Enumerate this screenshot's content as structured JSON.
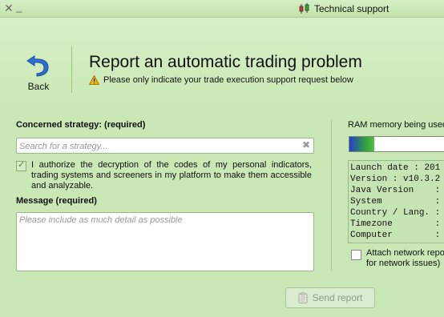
{
  "window": {
    "title": "Technical support",
    "close_glyph": "✕",
    "minimize_glyph": "_"
  },
  "header": {
    "back_label": "Back",
    "title": "Report an automatic trading problem",
    "subtitle": "Please only indicate your trade execution support request below"
  },
  "form": {
    "strategy_label": "Concerned strategy: (required)",
    "strategy_placeholder": "Search for a strategy...",
    "authorize_checked": true,
    "authorize_text": "I authorize the decryption of the codes of my personal indicators, trading systems and screeners in my platform to make them accessible and analyzable.",
    "message_label": "Message (required)",
    "message_placeholder": "Please include as much detail as possible",
    "send_label": "Send report"
  },
  "system": {
    "ram_label": "RAM memory being used",
    "ram_fraction": 0.25,
    "info_lines": [
      "Launch date : 201",
      "Version : v10.3.2",
      "Java Version    :",
      "System          :",
      "Country / Lang. :",
      "Timezone        :",
      "Computer        :"
    ],
    "attach_checked": false,
    "attach_line1": "Attach network repo",
    "attach_line2": "for network issues)"
  },
  "colors": {
    "background": "#c9e8b6",
    "accent_blue": "#2b6fd0"
  },
  "icons": {
    "app": "candlestick-icon",
    "back": "back-arrow-icon",
    "warning": "warning-icon",
    "clear": "clear-icon",
    "send": "clipboard-icon"
  }
}
